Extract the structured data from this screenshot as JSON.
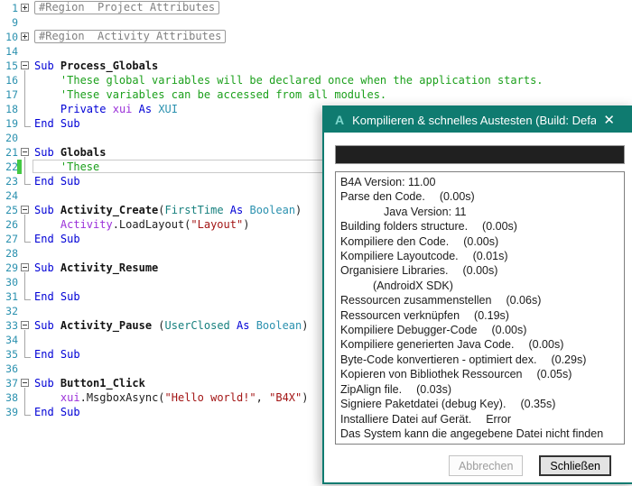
{
  "palette": {
    "kw": "#0000D6",
    "sub": "#141414",
    "cm": "#1CA01C",
    "pl": "#1e1e1e",
    "obj": "#9B30D9",
    "type": "#2B91AF",
    "param": "#17807E",
    "str": "#A31515",
    "line_number": "#2B91AF",
    "region_text": "#808080",
    "changed_line_marker": "#44C944",
    "titlebar": "#0F7B70",
    "titlebar_text": "#FFFFFF",
    "app_icon": "#7CD6CC",
    "progress_fill": "#202020"
  },
  "editor": {
    "lines": [
      {
        "num": 1,
        "fold": "plus",
        "region": "#Region  Project Attributes"
      },
      {
        "num": 9
      },
      {
        "num": 10,
        "fold": "plus",
        "region": "#Region  Activity Attributes"
      },
      {
        "num": 14
      },
      {
        "num": 15,
        "fold": "minus",
        "tokens": [
          [
            "kw",
            "Sub "
          ],
          [
            "sub",
            "Process_Globals"
          ]
        ]
      },
      {
        "num": 16,
        "fold": "body",
        "tokens": [
          [
            "pl",
            "    "
          ],
          [
            "cm",
            "'These global variables will be declared once when the application starts."
          ]
        ]
      },
      {
        "num": 17,
        "fold": "body",
        "tokens": [
          [
            "pl",
            "    "
          ],
          [
            "cm",
            "'These variables can be accessed from all modules."
          ]
        ]
      },
      {
        "num": 18,
        "fold": "body",
        "tokens": [
          [
            "pl",
            "    "
          ],
          [
            "kw",
            "Private"
          ],
          [
            "pl",
            " "
          ],
          [
            "obj",
            "xui"
          ],
          [
            "pl",
            " "
          ],
          [
            "kw",
            "As"
          ],
          [
            "pl",
            " "
          ],
          [
            "type",
            "XUI"
          ]
        ]
      },
      {
        "num": 19,
        "fold": "end",
        "tokens": [
          [
            "kw",
            "End Sub"
          ]
        ]
      },
      {
        "num": 20
      },
      {
        "num": 21,
        "fold": "minus",
        "tokens": [
          [
            "kw",
            "Sub "
          ],
          [
            "sub",
            "Globals"
          ]
        ]
      },
      {
        "num": 22,
        "fold": "body",
        "marker": true,
        "current": true,
        "tokens": [
          [
            "pl",
            "    "
          ],
          [
            "cm",
            "'These"
          ]
        ]
      },
      {
        "num": 23,
        "fold": "end",
        "tokens": [
          [
            "kw",
            "End Sub"
          ]
        ]
      },
      {
        "num": 24
      },
      {
        "num": 25,
        "fold": "minus",
        "tokens": [
          [
            "kw",
            "Sub "
          ],
          [
            "sub",
            "Activity_Create"
          ],
          [
            "pl",
            "("
          ],
          [
            "param",
            "FirstTime"
          ],
          [
            "pl",
            " "
          ],
          [
            "kw",
            "As"
          ],
          [
            "pl",
            " "
          ],
          [
            "type",
            "Boolean"
          ],
          [
            "pl",
            ")"
          ]
        ]
      },
      {
        "num": 26,
        "fold": "body",
        "tokens": [
          [
            "pl",
            "    "
          ],
          [
            "obj",
            "Activity"
          ],
          [
            "pl",
            ".LoadLayout("
          ],
          [
            "str",
            "\"Layout\""
          ],
          [
            "pl",
            ")"
          ]
        ]
      },
      {
        "num": 27,
        "fold": "end",
        "tokens": [
          [
            "kw",
            "End Sub"
          ]
        ]
      },
      {
        "num": 28
      },
      {
        "num": 29,
        "fold": "minus",
        "tokens": [
          [
            "kw",
            "Sub "
          ],
          [
            "sub",
            "Activity_Resume"
          ]
        ]
      },
      {
        "num": 30,
        "fold": "body",
        "tokens": []
      },
      {
        "num": 31,
        "fold": "end",
        "tokens": [
          [
            "kw",
            "End Sub"
          ]
        ]
      },
      {
        "num": 32
      },
      {
        "num": 33,
        "fold": "minus",
        "tokens": [
          [
            "kw",
            "Sub "
          ],
          [
            "sub",
            "Activity_Pause"
          ],
          [
            "pl",
            " ("
          ],
          [
            "param",
            "UserClosed"
          ],
          [
            "pl",
            " "
          ],
          [
            "kw",
            "As"
          ],
          [
            "pl",
            " "
          ],
          [
            "type",
            "Boolean"
          ],
          [
            "pl",
            ")"
          ]
        ]
      },
      {
        "num": 34,
        "fold": "body",
        "tokens": []
      },
      {
        "num": 35,
        "fold": "end",
        "tokens": [
          [
            "kw",
            "End Sub"
          ]
        ]
      },
      {
        "num": 36
      },
      {
        "num": 37,
        "fold": "minus",
        "tokens": [
          [
            "kw",
            "Sub "
          ],
          [
            "sub",
            "Button1_Click"
          ]
        ]
      },
      {
        "num": 38,
        "fold": "body",
        "tokens": [
          [
            "pl",
            "    "
          ],
          [
            "obj",
            "xui"
          ],
          [
            "pl",
            ".MsgboxAsync("
          ],
          [
            "str",
            "\"Hello world!\""
          ],
          [
            "pl",
            ", "
          ],
          [
            "str",
            "\"B4X\""
          ],
          [
            "pl",
            ")"
          ]
        ]
      },
      {
        "num": 39,
        "fold": "end",
        "tokens": [
          [
            "kw",
            "End Sub"
          ]
        ]
      }
    ]
  },
  "dialog": {
    "title": "Kompilieren & schnelles Austesten (Build: Defa...",
    "icon_letter": "A",
    "close_glyph": "✕",
    "abort_label": "Abbrechen",
    "close_label": "Schließen",
    "log": {
      "lines": [
        {
          "text": "B4A Version: 11.00"
        },
        {
          "text": "Parse den Code.",
          "time": "(0.00s)"
        },
        {
          "text": "Java Version: 11",
          "indent": 48
        },
        {
          "text": "Building folders structure.",
          "time": "(0.00s)"
        },
        {
          "text": "Kompiliere den Code.",
          "time": "(0.00s)"
        },
        {
          "text": "Kompiliere Layoutcode.",
          "time": "(0.01s)"
        },
        {
          "text": "Organisiere Libraries.",
          "time": "(0.00s)"
        },
        {
          "text": "(AndroidX SDK)",
          "indent": 36
        },
        {
          "text": "Ressourcen zusammenstellen",
          "time": "(0.06s)"
        },
        {
          "text": "Ressourcen verknüpfen",
          "time": "(0.19s)"
        },
        {
          "text": "Kompiliere Debugger-Code",
          "time": "(0.00s)"
        },
        {
          "text": "Kompiliere generierten Java Code.",
          "time": "(0.00s)"
        },
        {
          "text": "Byte-Code konvertieren - optimiert dex.",
          "time": "(0.29s)"
        },
        {
          "text": "Kopieren von Bibliothek Ressourcen",
          "time": "(0.05s)"
        },
        {
          "text": "ZipAlign file.",
          "time": "(0.03s)"
        },
        {
          "text": "Signiere Paketdatei (debug Key).",
          "time": "(0.35s)"
        },
        {
          "text": "Installiere Datei auf Gerät.",
          "time": "Error"
        },
        {
          "text": "Das System kann die angegebene Datei nicht finden"
        }
      ]
    }
  }
}
